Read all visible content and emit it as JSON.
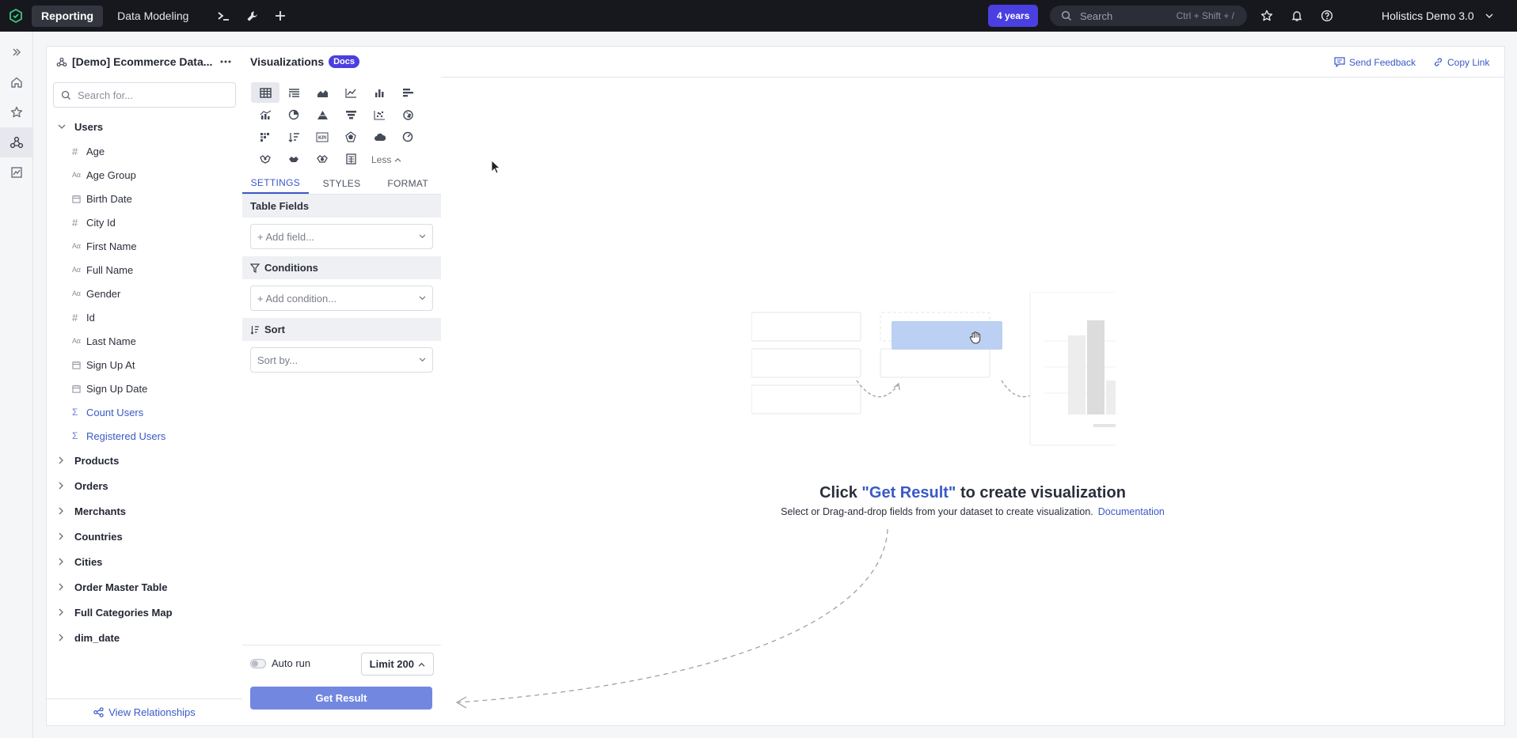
{
  "topbar": {
    "tabs": [
      "Reporting",
      "Data Modeling"
    ],
    "active_tab": "Reporting",
    "date_pill": "4 years",
    "search_placeholder": "Search",
    "search_shortcut": "Ctrl + Shift + /",
    "workspace": "Holistics Demo 3.0"
  },
  "dataset": {
    "title": "[Demo] Ecommerce Data...",
    "search_placeholder": "Search for...",
    "expanded_model": "Users",
    "fields": [
      {
        "type": "number",
        "label": "Age"
      },
      {
        "type": "text",
        "label": "Age Group"
      },
      {
        "type": "date",
        "label": "Birth Date"
      },
      {
        "type": "number",
        "label": "City Id"
      },
      {
        "type": "text",
        "label": "First Name"
      },
      {
        "type": "text",
        "label": "Full Name"
      },
      {
        "type": "text",
        "label": "Gender"
      },
      {
        "type": "number",
        "label": "Id"
      },
      {
        "type": "text",
        "label": "Last Name"
      },
      {
        "type": "date",
        "label": "Sign Up At"
      },
      {
        "type": "date",
        "label": "Sign Up Date"
      },
      {
        "type": "measure",
        "label": "Count Users"
      },
      {
        "type": "measure",
        "label": "Registered Users"
      }
    ],
    "models": [
      "Products",
      "Orders",
      "Merchants",
      "Countries",
      "Cities",
      "Order Master Table",
      "Full Categories Map",
      "dim_date"
    ],
    "view_relationships": "View Relationships"
  },
  "viz": {
    "title": "Visualizations",
    "docs_badge": "Docs",
    "less_label": "Less",
    "tabs": [
      "SETTINGS",
      "STYLES",
      "FORMAT"
    ],
    "active_tab": "SETTINGS",
    "sections": {
      "table_fields": "Table Fields",
      "add_field": "+ Add field...",
      "conditions": "Conditions",
      "add_condition": "+ Add condition...",
      "sort": "Sort",
      "sort_by": "Sort by..."
    },
    "auto_run": "Auto run",
    "limit": "Limit 200",
    "get_result": "Get Result"
  },
  "main": {
    "send_feedback": "Send Feedback",
    "copy_link": "Copy Link",
    "cta_prefix": "Click ",
    "cta_highlight": "\"Get Result\"",
    "cta_suffix": " to create visualization",
    "cta_sub": "Select or Drag-and-drop fields from your dataset to create visualization.",
    "documentation": "Documentation"
  },
  "colors": {
    "accent": "#3a59c7",
    "brand_purple": "#4a3fe0",
    "topbar": "#16181d",
    "button": "#7288e0"
  }
}
